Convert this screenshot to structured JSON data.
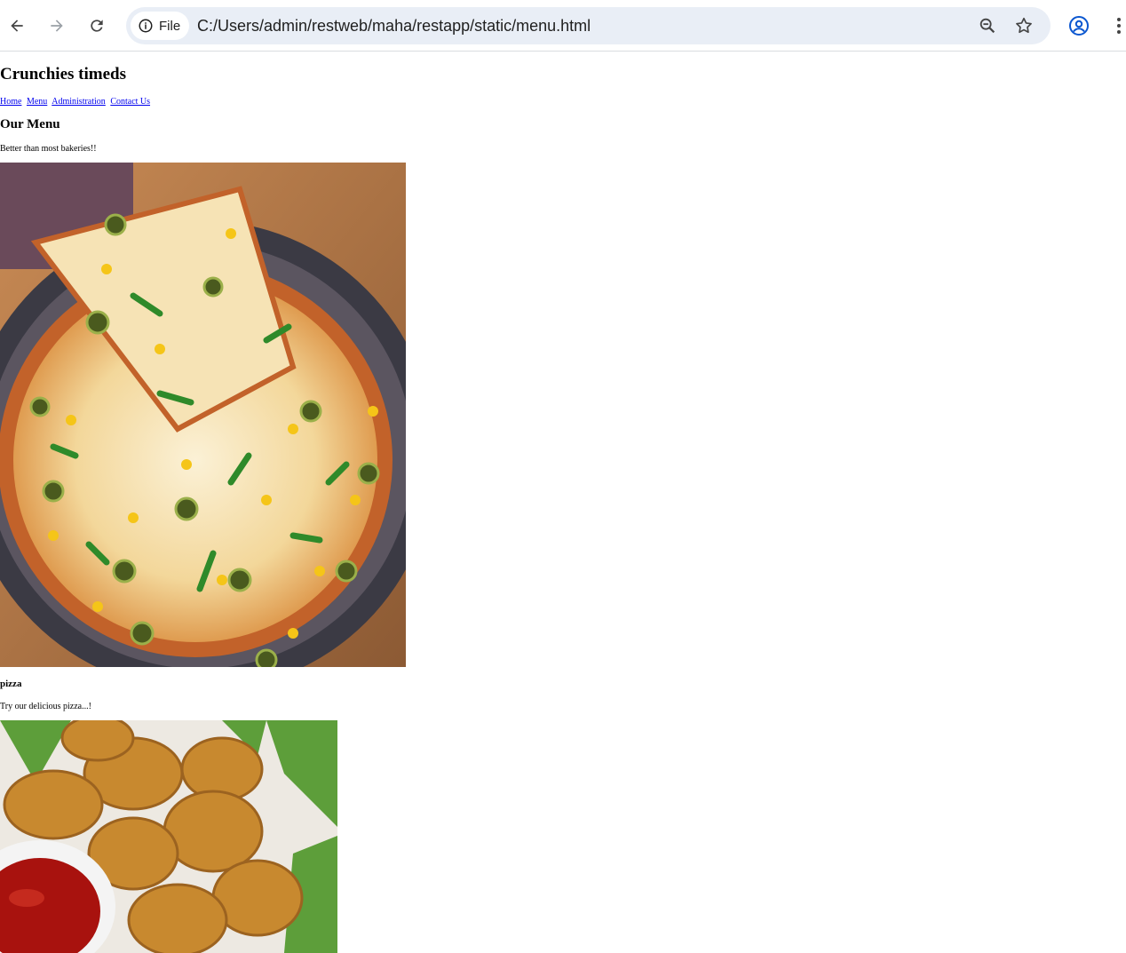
{
  "browser": {
    "chip_label": "File",
    "url": "C:/Users/admin/restweb/maha/restapp/static/menu.html",
    "icons": [
      "back-icon",
      "forward-icon",
      "reload-icon",
      "info-icon",
      "zoom-out-icon",
      "star-icon",
      "profile-icon",
      "more-menu-icon"
    ]
  },
  "site": {
    "title": "Crunchies timeds",
    "nav": [
      "Home",
      "Menu",
      "Administration",
      "Contact Us"
    ]
  },
  "menu": {
    "heading": "Our Menu",
    "tagline": "Better than most bakeries!!",
    "items": [
      {
        "name": "pizza",
        "description": "Try our delicious pizza...!"
      }
    ]
  },
  "colors": {
    "link": "#0000ee",
    "omnibox": "#e9eef6",
    "profile_blue": "#0b57d0"
  }
}
